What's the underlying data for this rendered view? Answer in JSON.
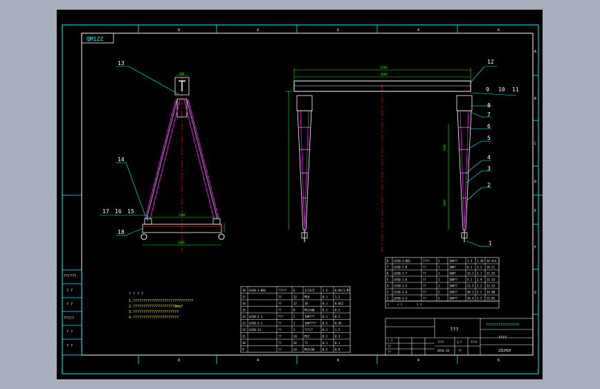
{
  "drawing": {
    "title_tag": "QM1ZZ",
    "colors": {
      "background": "#000000",
      "frame": "#00ffff",
      "frame_inner": "#ffffff",
      "structure": "#ffffff",
      "crane_legs": "#ff00ff",
      "centerline": "#ff0000",
      "dimension": "#00ff00",
      "leader": "#00ffff",
      "text": "#ffffff",
      "notes": "#ffff00"
    },
    "zone_numbers_top": [
      "8",
      "4",
      "6",
      "4",
      "6",
      "4"
    ],
    "zone_numbers_bottom": [
      "8",
      "4",
      "6",
      "4",
      "6",
      "4"
    ],
    "zone_letters_right": [
      "A",
      "B",
      "C",
      "D",
      "E",
      "F",
      "G"
    ],
    "left_strip_labels": [
      "??/???",
      "? ?",
      "? ?",
      "???/?",
      "? ?",
      "? ?"
    ],
    "part_balloons": [
      "1",
      "2",
      "3",
      "4",
      "5",
      "6",
      "7",
      "8",
      "9",
      "10",
      "11",
      "12",
      "13",
      "14",
      "15",
      "16",
      "17",
      "18"
    ],
    "dimensions": {
      "top_overall": "6300",
      "top_span": "4000",
      "side_height": "2000",
      "side_height2": "1800",
      "base_width": "2400",
      "base_width_lower": "2000",
      "gantry_top": "600"
    },
    "notes": {
      "heading": "? ? ? ?",
      "lines": [
        "1.?????????????????????????????",
        "2.????????????????????8mm?",
        "3.??????????????????????",
        "4.??????????????????????"
      ]
    }
  },
  "parts_table_left": {
    "rows": [
      [
        "18",
        "LH10-1-002",
        "???/?",
        "6",
        "1/13/2",
        "1.3",
        "8.8t/1.8t"
      ],
      [
        "17",
        "",
        "??",
        "12",
        "M16",
        "0.1",
        "1.2"
      ],
      [
        "16",
        "",
        "??",
        "12",
        "16",
        "0.1",
        "0.012"
      ],
      [
        "15",
        "",
        "??",
        "8",
        "M12×60",
        "0.1",
        "0.5"
      ],
      [
        "14",
        "LH10-2-1",
        "???",
        "2",
        "10#???",
        "0.1",
        "0.5"
      ],
      [
        "13",
        "LH10-3-1",
        "??",
        "1",
        "10#????",
        "0.2",
        "0.45"
      ],
      [
        "12",
        "LH10-13",
        "??",
        "2",
        "???/?",
        "0.1",
        "1.5"
      ],
      [
        "11",
        "",
        "??",
        "24",
        "M12",
        "0.2",
        "0.2"
      ],
      [
        "10",
        "",
        "??",
        "24",
        "?2",
        "0.1",
        "0.1"
      ],
      [
        "9",
        "",
        "??",
        "24",
        "M12×50",
        "0.3",
        "0.8"
      ]
    ]
  },
  "parts_table_right": {
    "rows": [
      [
        "8",
        "LH10-1-001",
        "????",
        "1",
        "10#??",
        "1.3",
        "1.30",
        "26.4/n.1"
      ],
      [
        "7",
        "LH10-1-8",
        "??",
        "1",
        "10#?",
        "6.1",
        "3.1",
        "18.11"
      ],
      [
        "6",
        "LH10-1-7",
        "??",
        "1",
        "10#?",
        "13.2",
        "2.1",
        "11.25"
      ],
      [
        "5",
        "LH10-1-6",
        "??",
        "1",
        "10#??",
        "5.1",
        "2.4",
        "11.15"
      ],
      [
        "4",
        "LH10-1-5",
        "??",
        "1",
        "10#??",
        "22.5",
        "2.2",
        "13.15"
      ],
      [
        "3",
        "LH10-1-4",
        "??",
        "2",
        "10#??",
        "48.1",
        "2.2",
        "14.00"
      ],
      [
        "2",
        "LH10-1-3",
        "??",
        "2",
        "10#??",
        "26.4",
        "2.2",
        "13.01"
      ]
    ],
    "header": [
      "?",
      "? ?",
      "? ?"
    ]
  },
  "title_block": {
    "company": "????????????????",
    "title": "???",
    "drawing_name": "????",
    "drawing_no": "????",
    "scale": "1:?",
    "sheet": "????",
    "code": "ZZLH10",
    "signatures": [
      "? ?",
      "??",
      "??"
    ],
    "dates": [
      "2016.10",
      "??"
    ]
  }
}
